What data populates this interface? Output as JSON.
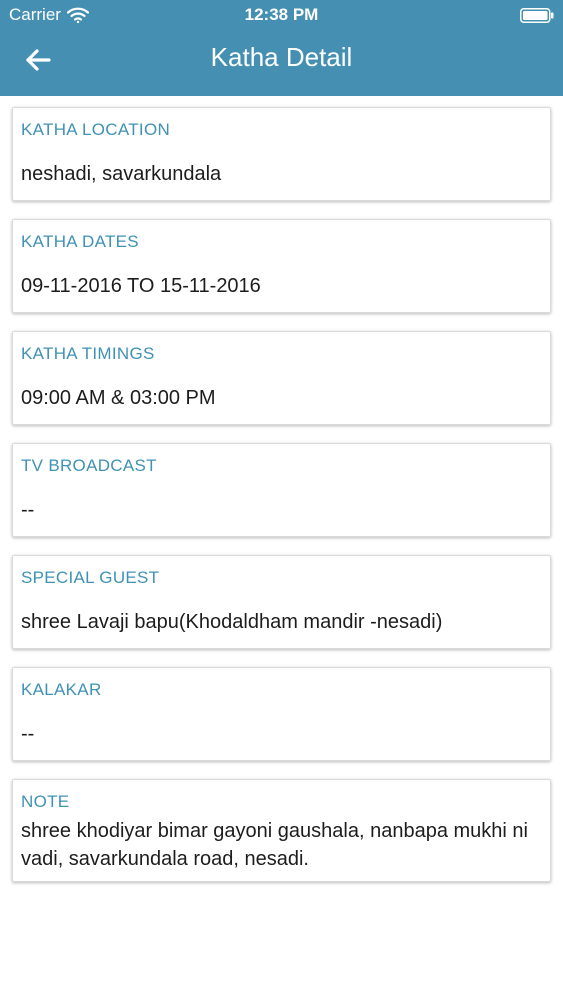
{
  "status_bar": {
    "carrier": "Carrier",
    "time": "12:38 PM",
    "icons": [
      "wifi-icon",
      "battery-icon"
    ]
  },
  "nav": {
    "title": "Katha Detail",
    "back_icon": "arrow-left-icon"
  },
  "colors": {
    "header": "#4590b2",
    "label": "#3f92b4",
    "value": "#1d1d1d"
  },
  "details": [
    {
      "label": "KATHA LOCATION",
      "value": "neshadi, savarkundala"
    },
    {
      "label": "KATHA DATES",
      "value": "09-11-2016 TO 15-11-2016"
    },
    {
      "label": "KATHA TIMINGS",
      "value": "09:00 AM & 03:00 PM"
    },
    {
      "label": "TV BROADCAST",
      "value": "--"
    },
    {
      "label": "SPECIAL GUEST",
      "value": "shree Lavaji bapu(Khodaldham mandir -nesadi)"
    },
    {
      "label": "KALAKAR",
      "value": "--"
    },
    {
      "label": "NOTE",
      "value": "shree khodiyar bimar gayoni gaushala, nanbapa mukhi ni vadi, savarkundala road, nesadi."
    }
  ]
}
